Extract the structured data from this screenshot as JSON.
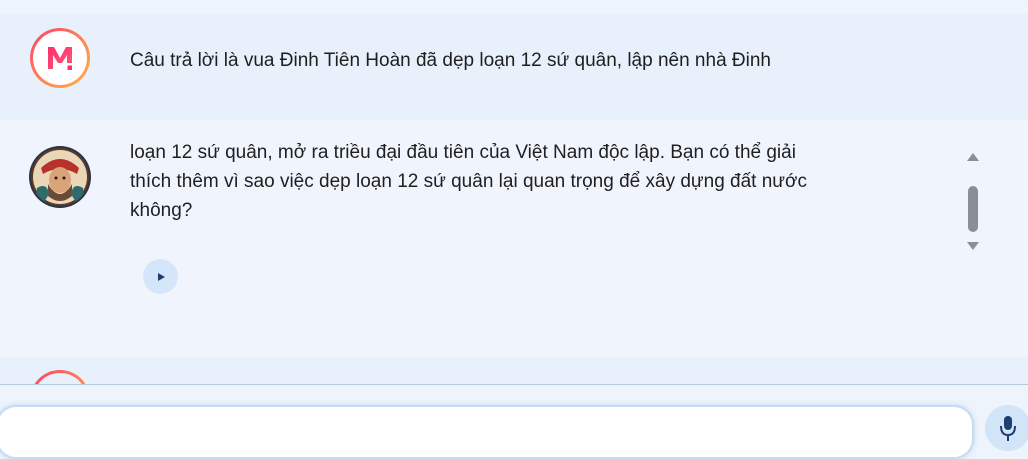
{
  "user_message": {
    "avatar_letter": "M",
    "text": "Câu trả lời là vua Đinh Tiên Hoàn đã dẹp loạn 12 sứ quân, lập nên nhà Đinh"
  },
  "bot_message": {
    "text_lines": [
      "loạn 12 sứ quân, mở ra triều đại đầu tiên của Việt Nam độc lập. Bạn có thể giải",
      "thích thêm vì sao việc dẹp loạn 12 sứ quân lại quan trọng để xây dựng đất nước",
      "không?"
    ],
    "play_icon": "play-icon"
  },
  "input": {
    "placeholder": ""
  },
  "colors": {
    "accent_gradient_start": "#ff3d6e",
    "accent_gradient_end": "#ffb347",
    "play_icon": "#1f3f73",
    "mic_icon": "#1f3f73"
  }
}
